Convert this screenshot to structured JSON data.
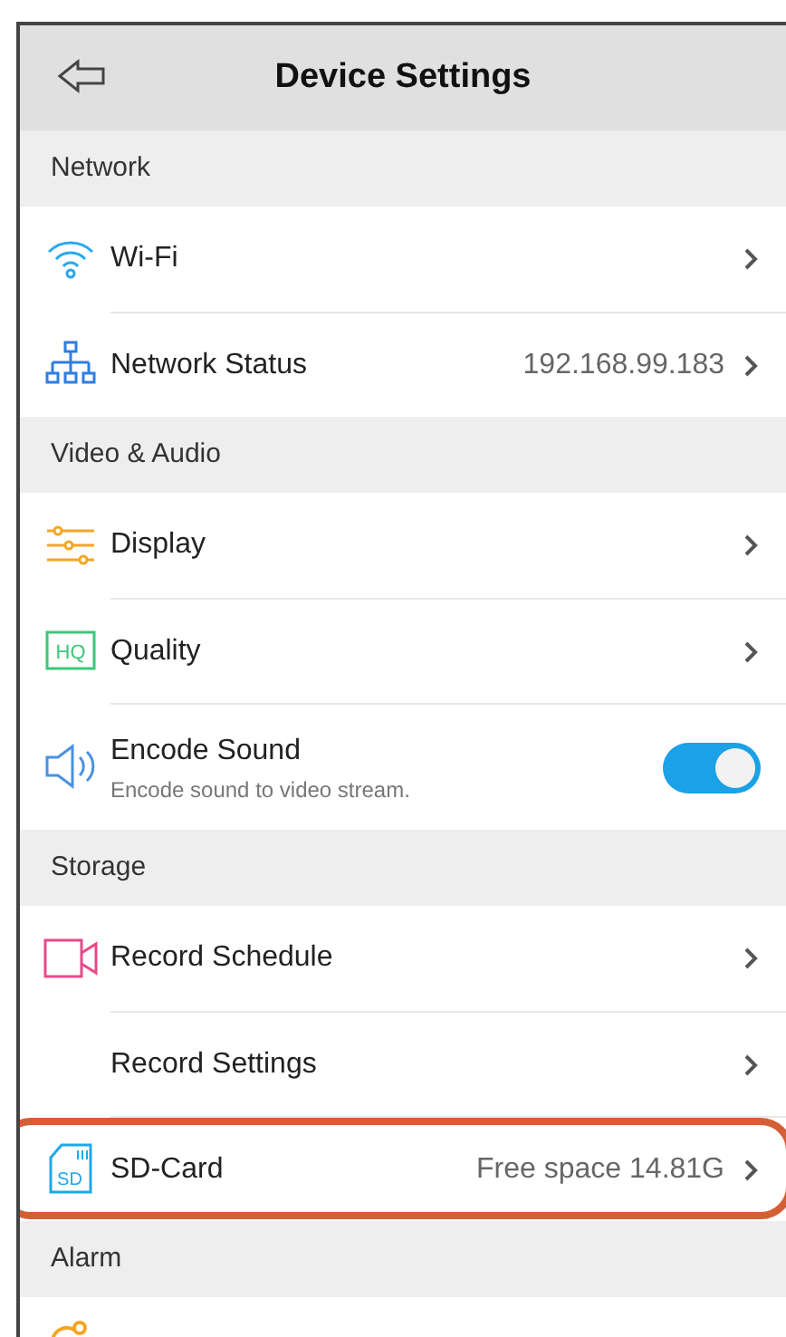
{
  "header": {
    "title": "Device Settings"
  },
  "sections": [
    {
      "title": "Network",
      "items": [
        {
          "kind": "link",
          "label": "Wi-Fi",
          "highlighted": false
        },
        {
          "kind": "link",
          "label": "Network Status",
          "value": "192.168.99.183",
          "highlighted": false
        }
      ]
    },
    {
      "title": "Video & Audio",
      "items": [
        {
          "kind": "link",
          "label": "Display",
          "highlighted": false
        },
        {
          "kind": "link",
          "icon_text": "HQ",
          "label": "Quality",
          "highlighted": false
        },
        {
          "kind": "toggle",
          "label": "Encode Sound",
          "subtitle": "Encode sound to video stream.",
          "on": true,
          "highlighted": false
        }
      ]
    },
    {
      "title": "Storage",
      "items": [
        {
          "kind": "link",
          "label": "Record Schedule",
          "highlighted": false
        },
        {
          "kind": "link",
          "label": "Record Settings",
          "highlighted": false
        },
        {
          "kind": "link",
          "icon_text": "SD",
          "label": "SD-Card",
          "value": "Free space 14.81G",
          "highlighted": true
        }
      ]
    },
    {
      "title": "Alarm",
      "items": [
        {
          "kind": "partial"
        }
      ]
    }
  ]
}
